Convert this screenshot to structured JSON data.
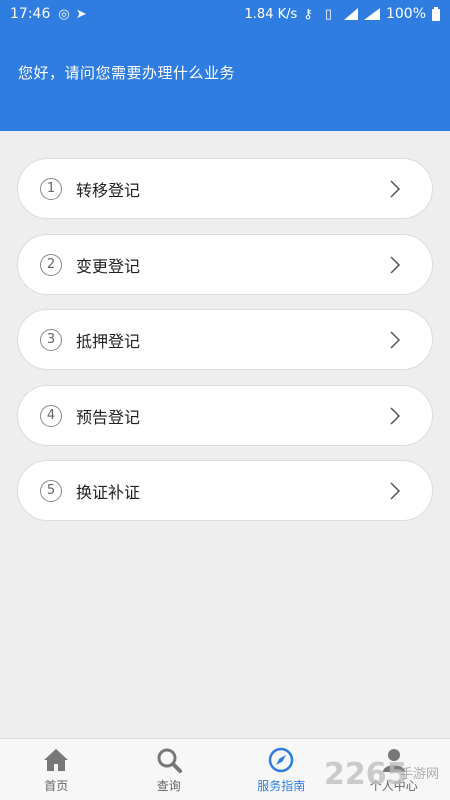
{
  "statusbar": {
    "time": "17:46",
    "speed": "1.84 K/s",
    "network": "4G",
    "battery": "100%"
  },
  "header": {
    "greeting": "您好，请问您需要办理什么业务"
  },
  "items": [
    {
      "num": "1",
      "label": "转移登记"
    },
    {
      "num": "2",
      "label": "变更登记"
    },
    {
      "num": "3",
      "label": "抵押登记"
    },
    {
      "num": "4",
      "label": "预告登记"
    },
    {
      "num": "5",
      "label": "换证补证"
    }
  ],
  "tabbar": {
    "tabs": [
      {
        "label": "首页",
        "icon": "home-icon"
      },
      {
        "label": "查询",
        "icon": "search-icon"
      },
      {
        "label": "服务指南",
        "icon": "compass-icon"
      },
      {
        "label": "个人中心",
        "icon": "person-icon"
      }
    ],
    "active_index": 2
  },
  "colors": {
    "brand": "#2f7de1",
    "background": "#eeeeee"
  },
  "watermark": {
    "text": "2265手游网"
  }
}
